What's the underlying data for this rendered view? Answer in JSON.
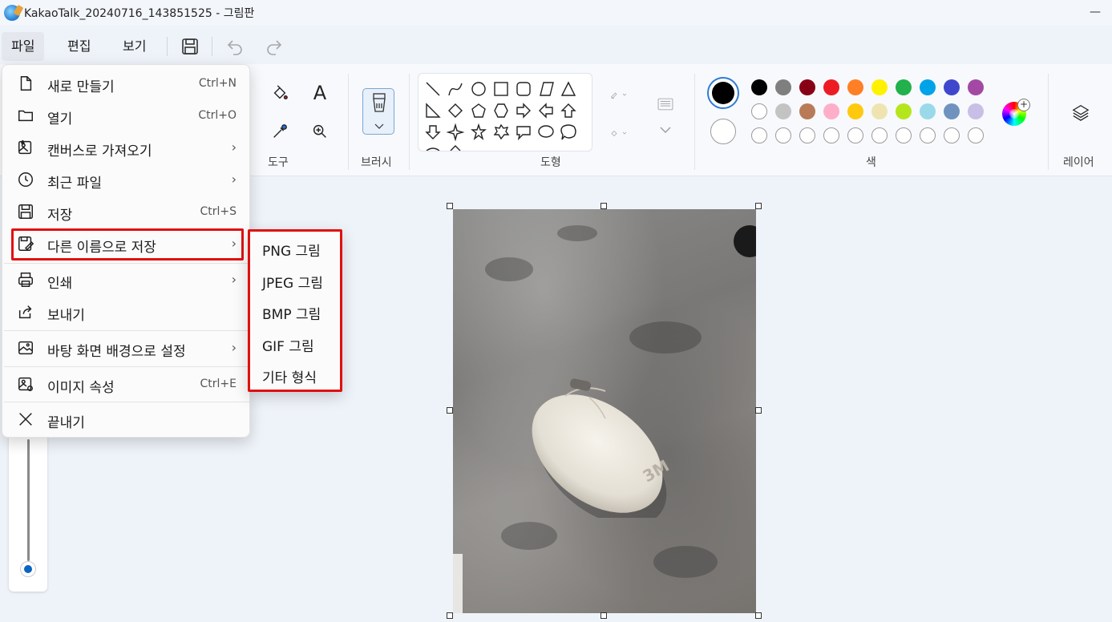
{
  "window": {
    "title": "KakaoTalk_20240716_143851525 - 그림판",
    "minimize": "—"
  },
  "menubar": {
    "file": "파일",
    "edit": "편집",
    "view": "보기"
  },
  "ribbon": {
    "tools_label": "도구",
    "brush_label": "브러시",
    "shapes_label": "도형",
    "colors_label": "색",
    "layers_label": "레이어",
    "text_tool": "A",
    "palette_row1": [
      "#000000",
      "#7f7f7f",
      "#880015",
      "#ed1c24",
      "#ff7f27",
      "#fff200",
      "#22b14c",
      "#00a2e8",
      "#3f48cc",
      "#a349a4"
    ],
    "palette_row2": [
      "#ffffff",
      "#c3c3c3",
      "#b97a57",
      "#ffaec9",
      "#ffc90e",
      "#efe4b0",
      "#b5e61d",
      "#99d9ea",
      "#7092be",
      "#c8bfe7"
    ]
  },
  "file_menu": {
    "items": [
      {
        "label": "새로 만들기",
        "shortcut": "Ctrl+N",
        "icon": "new-file-icon"
      },
      {
        "label": "열기",
        "shortcut": "Ctrl+O",
        "icon": "folder-icon"
      },
      {
        "label": "캔버스로 가져오기",
        "chevron": "›",
        "icon": "import-image-icon"
      },
      {
        "label": "최근 파일",
        "chevron": "›",
        "icon": "clock-icon"
      },
      {
        "label": "저장",
        "shortcut": "Ctrl+S",
        "icon": "save-icon"
      },
      {
        "label": "다른 이름으로 저장",
        "chevron": "›",
        "icon": "save-as-icon"
      },
      {
        "label": "인쇄",
        "chevron": "›",
        "icon": "printer-icon"
      },
      {
        "label": "보내기",
        "icon": "share-icon"
      },
      {
        "label": "바탕 화면 배경으로 설정",
        "chevron": "›",
        "icon": "wallpaper-icon"
      },
      {
        "label": "이미지 속성",
        "shortcut": "Ctrl+E",
        "icon": "image-properties-icon"
      },
      {
        "label": "끝내기",
        "icon": "close-icon"
      }
    ]
  },
  "save_as_submenu": {
    "items": [
      "PNG 그림",
      "JPEG 그림",
      "BMP 그림",
      "GIF 그림",
      "기타 형식"
    ]
  },
  "photo": {
    "brand_mark": "3M"
  }
}
